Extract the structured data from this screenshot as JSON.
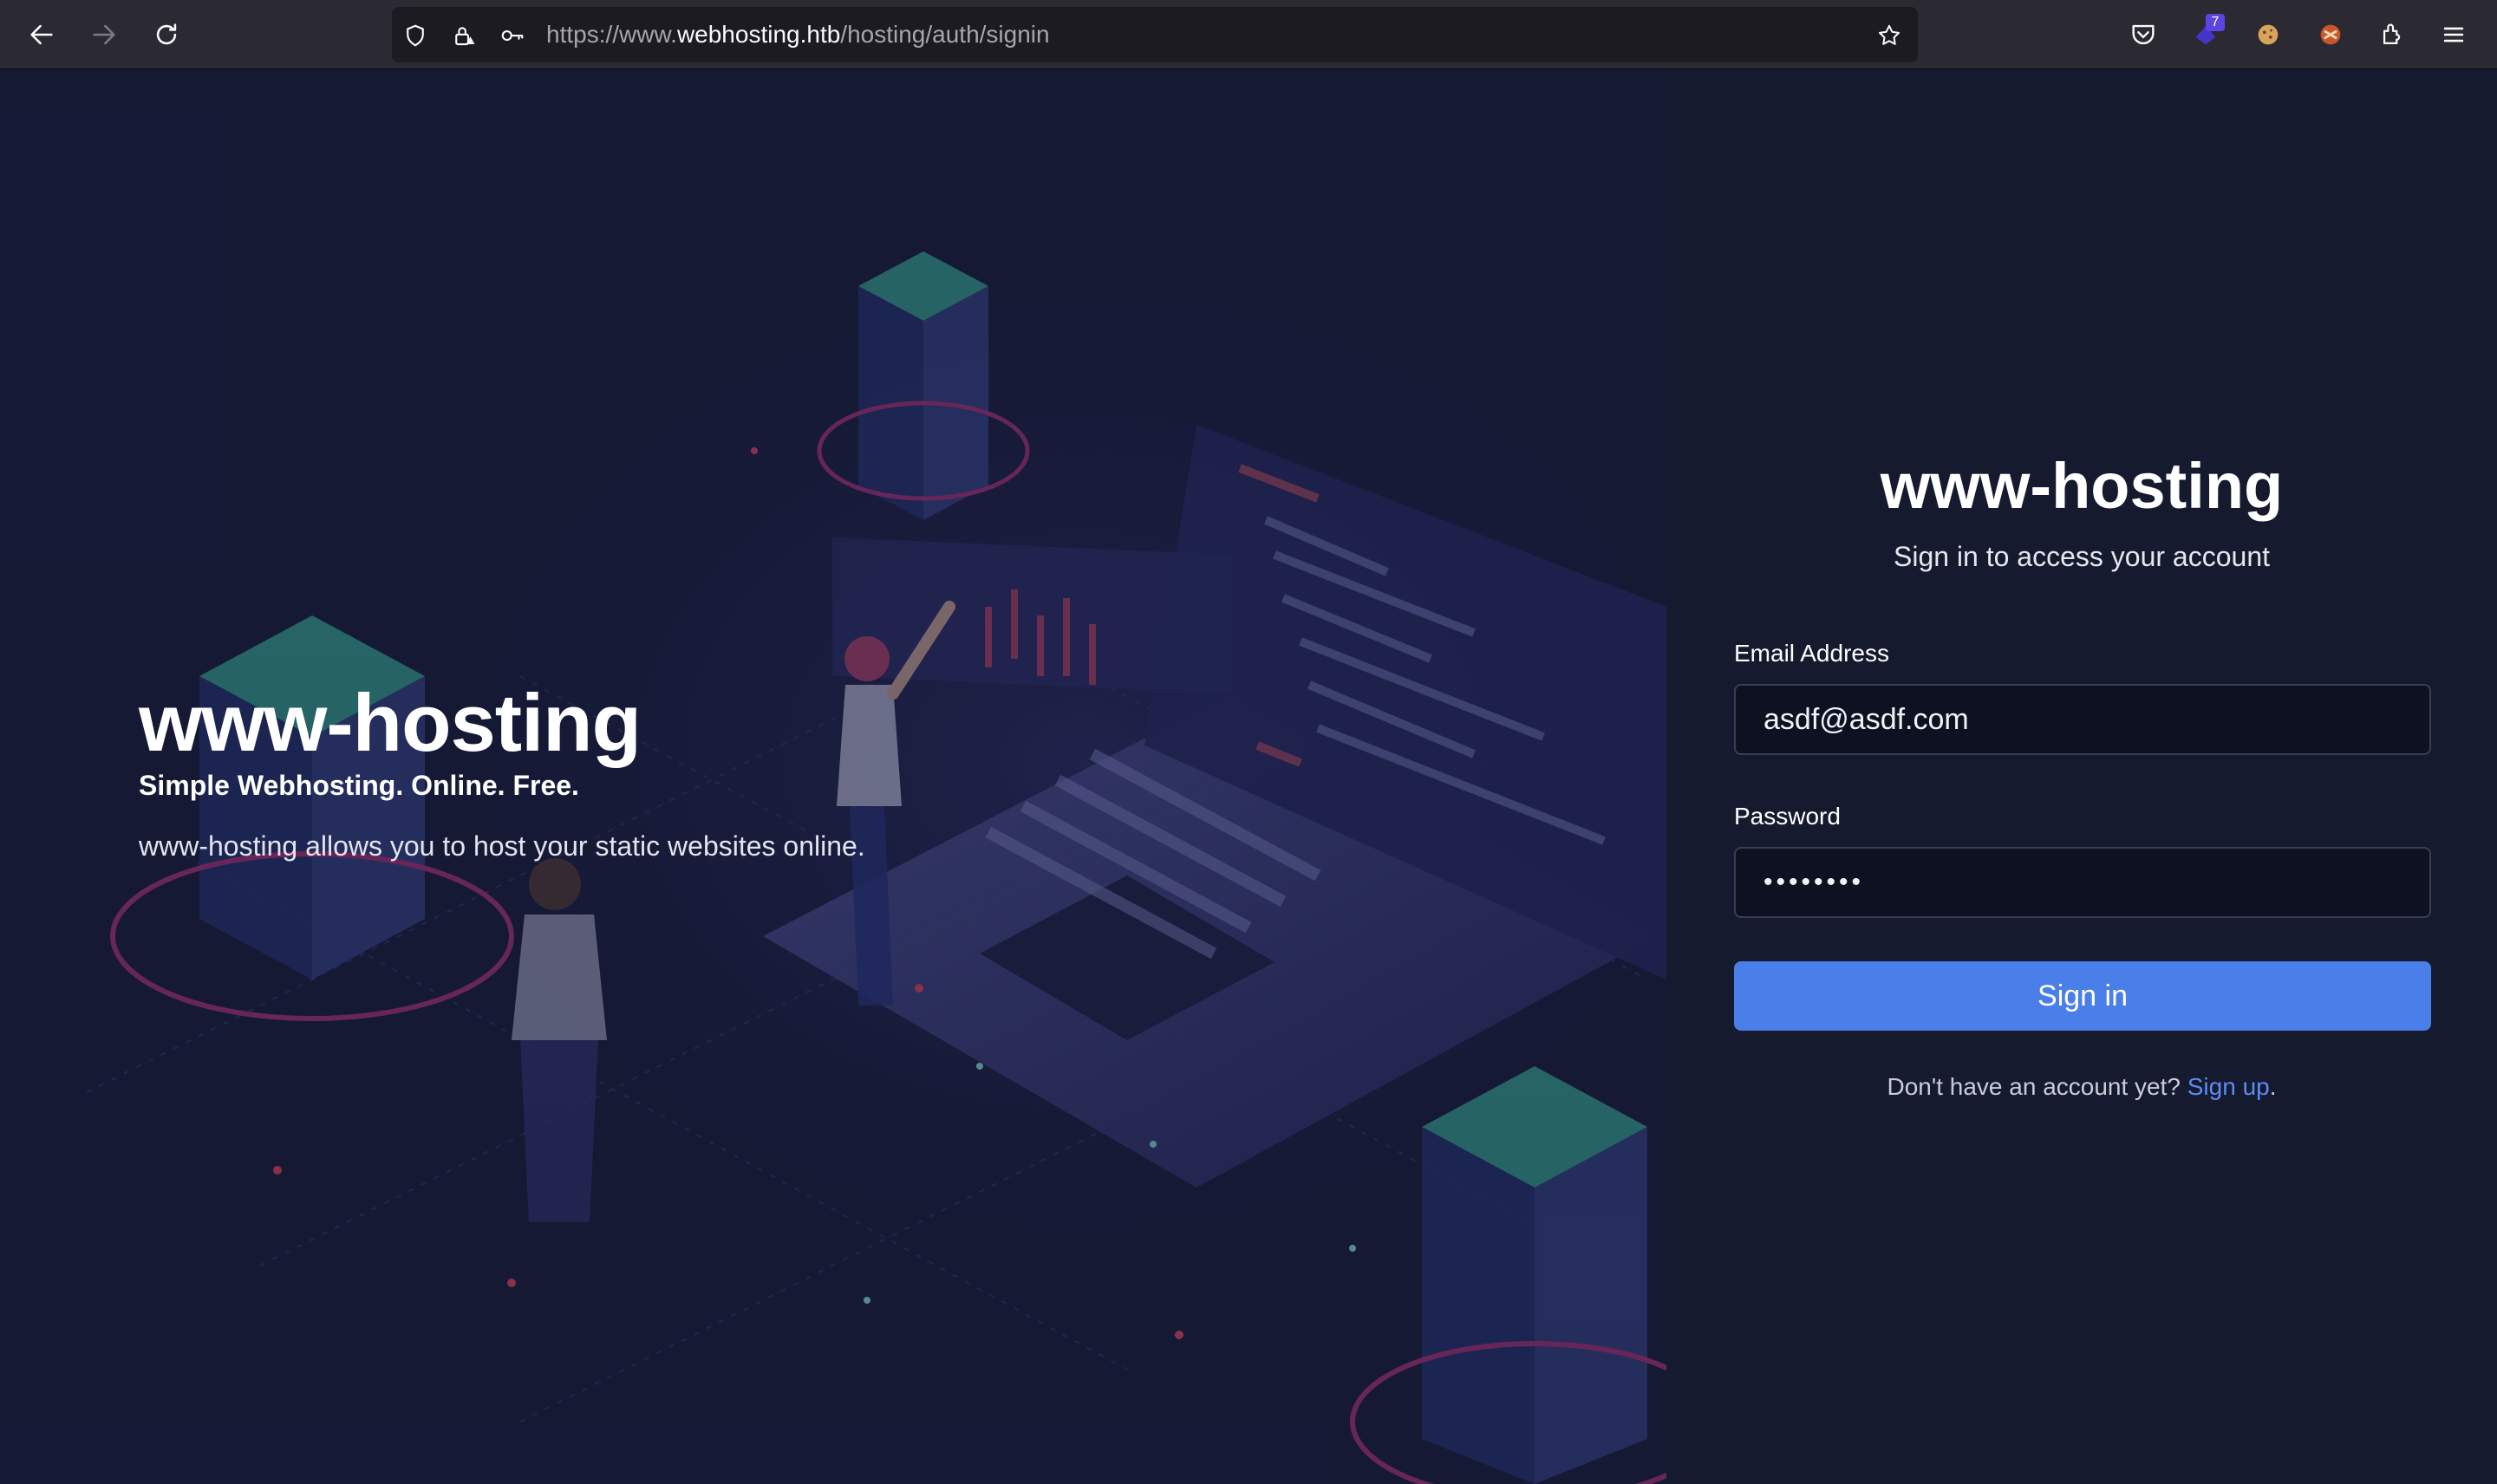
{
  "browser": {
    "url_scheme": "https://www.",
    "url_host": "webhosting.htb",
    "url_path": "/hosting/auth/signin",
    "extension_badge": "7",
    "icons": [
      "back-arrow-icon",
      "forward-arrow-icon",
      "reload-icon",
      "shield-icon",
      "insecure-lock-icon",
      "key-icon",
      "bookmark-star-icon",
      "pocket-icon",
      "extension-badge-icon",
      "cookie-icon",
      "addon-icon",
      "extensions-puzzle-icon",
      "hamburger-menu-icon"
    ]
  },
  "hero": {
    "title": "www-hosting",
    "tagline": "Simple Webhosting. Online. Free.",
    "description": "www-hosting allows you to host your static websites online."
  },
  "signin": {
    "brand": "www-hosting",
    "subtitle": "Sign in to access your account",
    "email_label": "Email Address",
    "email_value": "asdf@asdf.com",
    "password_label": "Password",
    "password_masked": "••••••••",
    "button_label": "Sign in",
    "footer_text": "Don't have an account yet? ",
    "footer_link": "Sign up",
    "footer_end": "."
  },
  "colors": {
    "accent": "#4a7ee8",
    "link": "#5a8cf5",
    "panel_bg": "#161a2f",
    "hero_bg": "#1b1f3b"
  }
}
